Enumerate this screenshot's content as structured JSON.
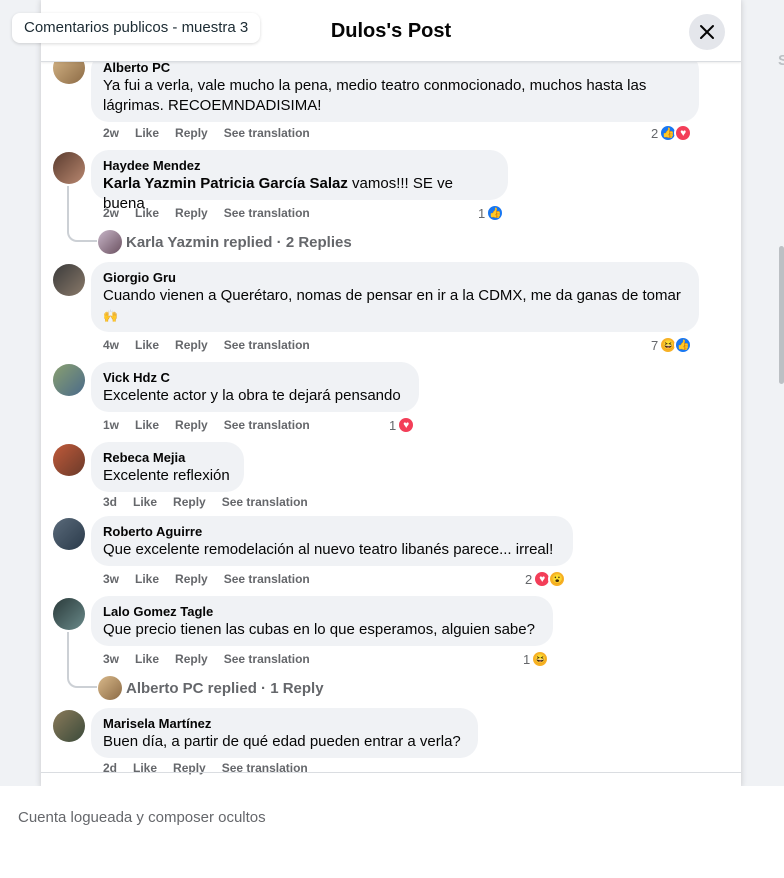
{
  "overlay_chip": "Comentarios publicos - muestra 3",
  "modal": {
    "title": "Dulos's Post",
    "close_icon": "close-icon"
  },
  "background": {
    "right_letter": "S"
  },
  "action_labels": {
    "like": "Like",
    "reply": "Reply",
    "translate": "See translation"
  },
  "comments": [
    {
      "author": "Alberto PC",
      "text": "Ya fui a verla, vale mucho la pena, medio teatro conmocionado, muchos hasta las lágrimas. RECOEMNDADISIMA!",
      "time": "2w",
      "reaction_count": "2",
      "reactions": [
        "like",
        "love"
      ]
    },
    {
      "author": "Haydee Mendez",
      "mention": "Karla Yazmin Patricia García Salaz",
      "text": " vamos!!! SE ve buena",
      "time": "2w",
      "reaction_count": "1",
      "reactions": [
        "like"
      ],
      "replies": {
        "who": "Karla Yazmin replied",
        "sep": " · ",
        "count": "2 Replies"
      }
    },
    {
      "author": "Giorgio Gru",
      "text": "Cuando vienen a Querétaro, nomas de pensar en ir a la CDMX, me da ganas de tomar",
      "emoji": "🙌",
      "time": "4w",
      "reaction_count": "7",
      "reactions": [
        "haha",
        "like"
      ]
    },
    {
      "author": "Vick Hdz C",
      "text": "Excelente actor y la obra te dejará pensando",
      "time": "1w",
      "reaction_count": "1",
      "reactions": [
        "love"
      ]
    },
    {
      "author": "Rebeca Mejia",
      "text": "Excelente reflexión",
      "time": "3d"
    },
    {
      "author": "Roberto Aguirre",
      "text": "Que excelente remodelación al nuevo teatro libanés parece... irreal!",
      "time": "3w",
      "reaction_count": "2",
      "reactions": [
        "love",
        "wow"
      ]
    },
    {
      "author": "Lalo Gomez Tagle",
      "text": "Que precio tienen las cubas en lo que esperamos, alguien sabe?",
      "time": "3w",
      "reaction_count": "1",
      "reactions": [
        "haha"
      ],
      "replies": {
        "who": "Alberto PC replied",
        "sep": " · ",
        "count": "1 Reply"
      }
    },
    {
      "author": "Marisela Martínez",
      "text": "Buen día, a partir de qué edad pueden entrar a verla?",
      "time": "2d"
    }
  ],
  "footer": {
    "text": "Cuenta logueada y composer ocultos"
  }
}
